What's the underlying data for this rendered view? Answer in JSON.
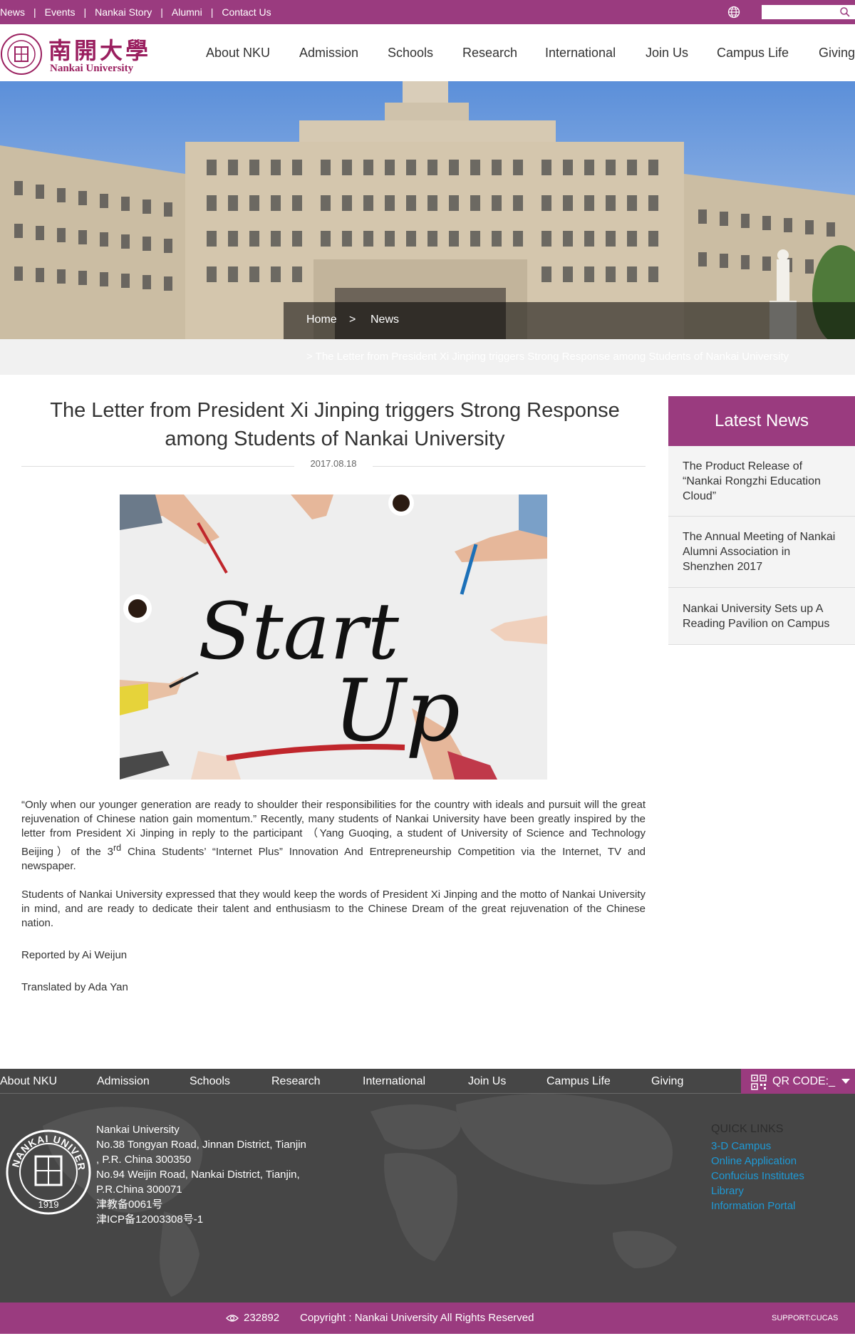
{
  "topbar": {
    "links": [
      "News",
      "Events",
      "Nankai Story",
      "Alumni",
      "Contact Us"
    ],
    "separator": "|",
    "search_placeholder": ""
  },
  "header": {
    "logo_cn": "南開大學",
    "logo_en": "Nankai University",
    "nav": [
      "About NKU",
      "Admission",
      "Schools",
      "Research",
      "International",
      "Join Us",
      "Campus Life",
      "Giving"
    ]
  },
  "breadcrumb": {
    "home": "Home",
    "sep": ">",
    "section": "News",
    "current": ">   The Letter from President Xi Jinping triggers Strong Response among Students of Nankai University"
  },
  "article": {
    "title": "The Letter from President Xi Jinping triggers Strong Response among Students of Nankai University",
    "date": "2017.08.18",
    "image_text_1": "Start",
    "image_text_2": "Up",
    "para1_a": "“Only when our younger generation are ready to shoulder their responsibilities for the country with ideals and pursuit will the great rejuvenation of Chinese nation gain momentum.” Recently, many students of Nankai University have been greatly inspired by the letter from President Xi Jinping in reply to the participant （Yang Guoqing, a student of University of Science and Technology Beijing）of the 3",
    "para1_sup": "rd",
    "para1_b": " China Students’ “Internet Plus” Innovation And Entrepreneurship Competition via the Internet, TV and newspaper.",
    "para2": "Students of Nankai University expressed that they would keep the words of President Xi Jinping and the motto of Nankai University in mind, and are ready to dedicate their talent and enthusiasm to the Chinese Dream of the great rejuvenation of the Chinese nation.",
    "reporter": "Reported by Ai Weijun",
    "translator": "Translated by Ada Yan"
  },
  "sidebar": {
    "heading": "Latest News",
    "items": [
      [
        "The Product Release of",
        "“Nankai Rongzhi Education",
        "Cloud”"
      ],
      [
        "The Annual Meeting of Nankai",
        "Alumni Association in",
        "Shenzhen 2017"
      ],
      [
        "Nankai University Sets up A",
        "Reading Pavilion on Campus"
      ]
    ]
  },
  "footer": {
    "nav": [
      "About NKU",
      "Admission",
      "Schools",
      "Research",
      "International",
      "Join Us",
      "Campus Life",
      "Giving"
    ],
    "qr_label": "QR CODE:_",
    "address": [
      "Nankai University",
      "No.38 Tongyan Road, Jinnan District, Tianjin",
      ", P.R. China 300350",
      "No.94 Weijin Road,  Nankai District, Tianjin,",
      "P.R.China  300071",
      "津教备0061号",
      "津ICP备12003308号-1"
    ],
    "quick_links_title": "QUICK LINKS",
    "quick_links": [
      "3-D Campus",
      "Online Application",
      "Confucius Institutes",
      "Library",
      "Information Portal"
    ],
    "seal_text": "NANKAI UNIVERSITY",
    "seal_year": "1919"
  },
  "bottom": {
    "visits": "232892",
    "copyright": "Copyright : Nankai University All Rights Reserved",
    "support": "SUPPORT:CUCAS"
  },
  "colors": {
    "brand": "#9a3b7f",
    "footer_bg": "#464646",
    "link": "#1e9ad6"
  }
}
